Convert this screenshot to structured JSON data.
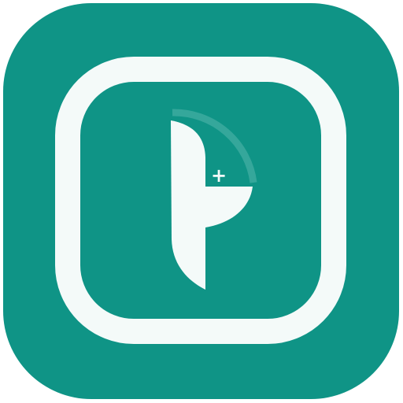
{
  "icon": {
    "name": "app-icon",
    "logo_text": "+",
    "colors": {
      "tile": "#0f9486",
      "frame": "#f4faf9",
      "logo": "#f4faf9",
      "arc": "#35a79b",
      "background": "#ffffff"
    }
  }
}
